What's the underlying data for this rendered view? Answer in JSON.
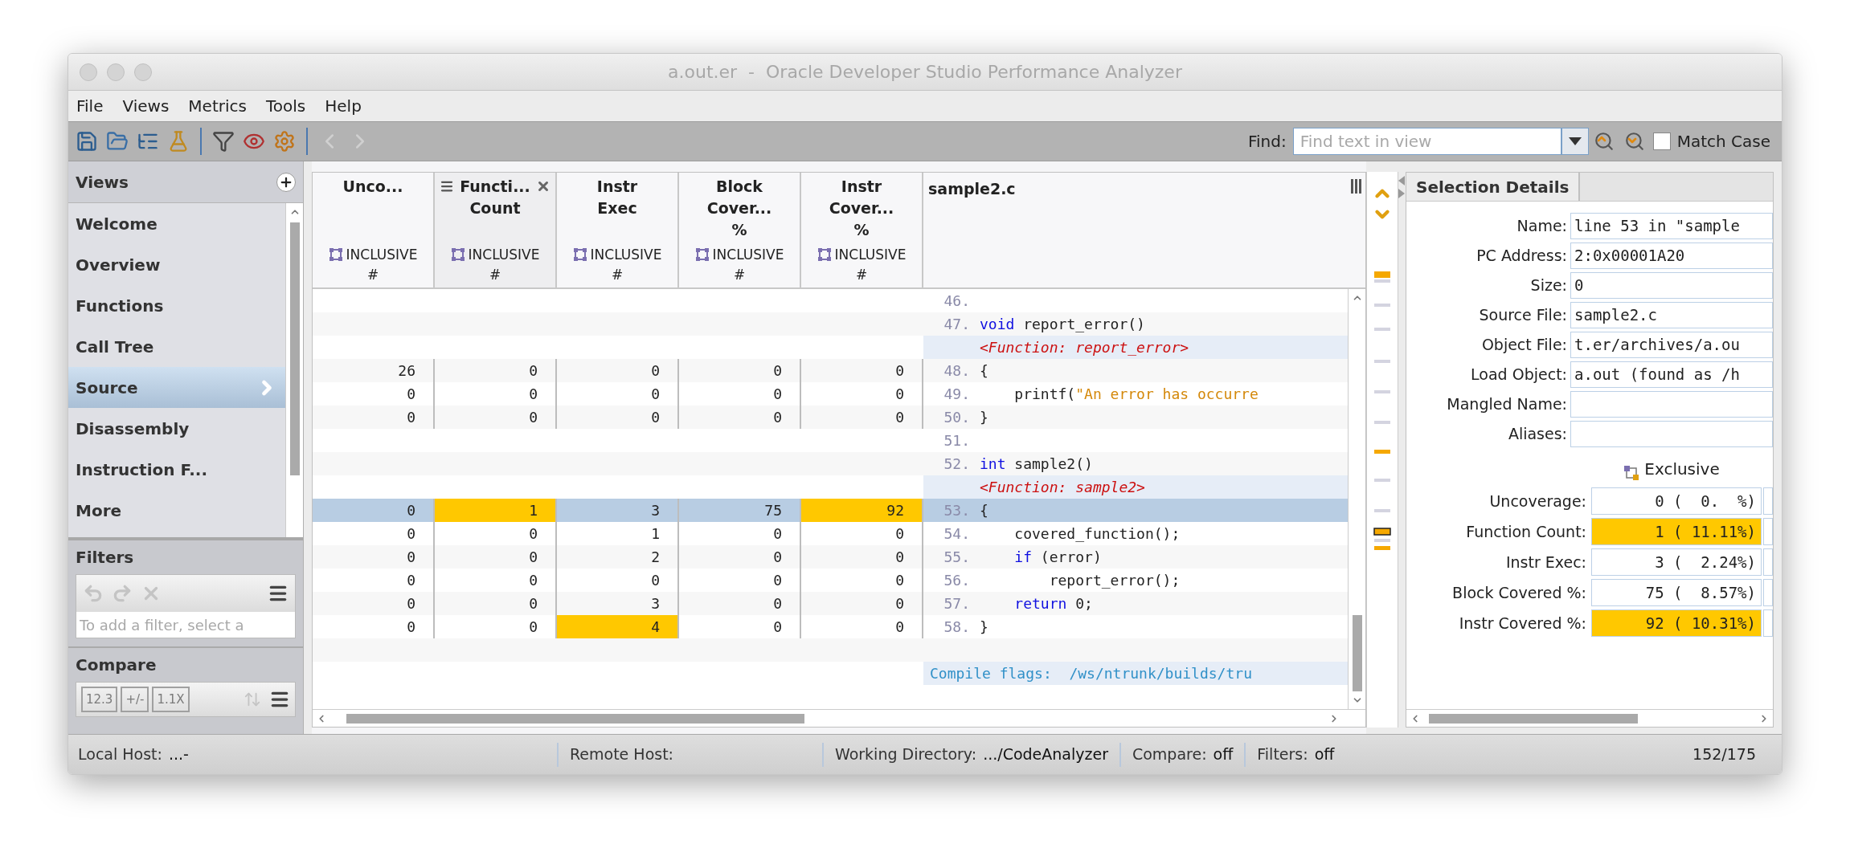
{
  "window": {
    "title": "a.out.er  -  Oracle Developer Studio Performance Analyzer"
  },
  "menu": [
    {
      "label": "File"
    },
    {
      "label": "Views"
    },
    {
      "label": "Metrics"
    },
    {
      "label": "Tools"
    },
    {
      "label": "Help"
    }
  ],
  "find": {
    "label": "Find:",
    "placeholder": "Find text in view",
    "match_case": {
      "label": "Match Case",
      "checked": false
    }
  },
  "sidebar": {
    "title": "Views",
    "items": [
      {
        "label": "Welcome",
        "selected": false
      },
      {
        "label": "Overview",
        "selected": false
      },
      {
        "label": "Functions",
        "selected": false
      },
      {
        "label": "Call Tree",
        "selected": false
      },
      {
        "label": "Source",
        "selected": true
      },
      {
        "label": "Disassembly",
        "selected": false
      },
      {
        "label": "Instruction F...",
        "selected": false
      },
      {
        "label": "More",
        "selected": false
      }
    ]
  },
  "filters": {
    "title": "Filters",
    "placeholder": "To add a filter, select a"
  },
  "compare": {
    "title": "Compare",
    "buttons": [
      "12.3",
      "+/-",
      "1.1X"
    ]
  },
  "table": {
    "columns": [
      {
        "title": [
          "Unco..."
        ],
        "scope": "INCLUSIVE",
        "unit": "#",
        "sorted": false
      },
      {
        "title": [
          "Functi...",
          "Count"
        ],
        "scope": "INCLUSIVE",
        "unit": "#",
        "sorted": true
      },
      {
        "title": [
          "Instr",
          "Exec"
        ],
        "scope": "INCLUSIVE",
        "unit": "#",
        "sorted": false
      },
      {
        "title": [
          "Block",
          "Cover...",
          "%"
        ],
        "scope": "INCLUSIVE",
        "unit": "#",
        "sorted": false
      },
      {
        "title": [
          "Instr",
          "Cover...",
          "%"
        ],
        "scope": "INCLUSIVE",
        "unit": "#",
        "sorted": false
      }
    ],
    "source_title": "sample2.c",
    "rows": [
      {
        "kind": "line",
        "number": "46.",
        "selected": false
      },
      {
        "kind": "line",
        "number": "47.",
        "selected": false,
        "code": [
          {
            "text": "void",
            "kind": "keyword"
          },
          {
            "text": " report_error()",
            "kind": "plain"
          }
        ]
      },
      {
        "kind": "function",
        "label": "<Function: report_error>",
        "selected": false
      },
      {
        "kind": "line",
        "number": "48.",
        "selected": false,
        "values": [
          {
            "text": "26",
            "hot": false
          },
          {
            "text": "0",
            "hot": false
          },
          {
            "text": "0",
            "hot": false
          },
          {
            "text": "0",
            "hot": false
          },
          {
            "text": "0",
            "hot": false
          }
        ],
        "code": [
          {
            "text": "{",
            "kind": "plain"
          }
        ]
      },
      {
        "kind": "line",
        "number": "49.",
        "selected": false,
        "values": [
          {
            "text": "0",
            "hot": false
          },
          {
            "text": "0",
            "hot": false
          },
          {
            "text": "0",
            "hot": false
          },
          {
            "text": "0",
            "hot": false
          },
          {
            "text": "0",
            "hot": false
          }
        ],
        "code": [
          {
            "text": "    printf(",
            "kind": "plain"
          },
          {
            "text": "\"An error has occurre",
            "kind": "string"
          }
        ]
      },
      {
        "kind": "line",
        "number": "50.",
        "selected": false,
        "values": [
          {
            "text": "0",
            "hot": false
          },
          {
            "text": "0",
            "hot": false
          },
          {
            "text": "0",
            "hot": false
          },
          {
            "text": "0",
            "hot": false
          },
          {
            "text": "0",
            "hot": false
          }
        ],
        "code": [
          {
            "text": "}",
            "kind": "plain"
          }
        ]
      },
      {
        "kind": "line",
        "number": "51.",
        "selected": false
      },
      {
        "kind": "line",
        "number": "52.",
        "selected": false,
        "code": [
          {
            "text": "int",
            "kind": "keyword"
          },
          {
            "text": " sample2()",
            "kind": "plain"
          }
        ]
      },
      {
        "kind": "function",
        "label": "<Function: sample2>",
        "selected": false
      },
      {
        "kind": "line",
        "number": "53.",
        "selected": true,
        "values": [
          {
            "text": "0",
            "hot": false
          },
          {
            "text": "1",
            "hot": true
          },
          {
            "text": "3",
            "hot": false
          },
          {
            "text": "75",
            "hot": false
          },
          {
            "text": "92",
            "hot": true
          }
        ],
        "code": [
          {
            "text": "{",
            "kind": "plain"
          }
        ]
      },
      {
        "kind": "line",
        "number": "54.",
        "selected": false,
        "values": [
          {
            "text": "0",
            "hot": false
          },
          {
            "text": "0",
            "hot": false
          },
          {
            "text": "1",
            "hot": false
          },
          {
            "text": "0",
            "hot": false
          },
          {
            "text": "0",
            "hot": false
          }
        ],
        "code": [
          {
            "text": "    covered_function();",
            "kind": "plain"
          }
        ]
      },
      {
        "kind": "line",
        "number": "55.",
        "selected": false,
        "values": [
          {
            "text": "0",
            "hot": false
          },
          {
            "text": "0",
            "hot": false
          },
          {
            "text": "2",
            "hot": false
          },
          {
            "text": "0",
            "hot": false
          },
          {
            "text": "0",
            "hot": false
          }
        ],
        "code": [
          {
            "text": "    if",
            "kind": "keyword"
          },
          {
            "text": " (error)",
            "kind": "plain"
          }
        ]
      },
      {
        "kind": "line",
        "number": "56.",
        "selected": false,
        "values": [
          {
            "text": "0",
            "hot": false
          },
          {
            "text": "0",
            "hot": false
          },
          {
            "text": "0",
            "hot": false
          },
          {
            "text": "0",
            "hot": false
          },
          {
            "text": "0",
            "hot": false
          }
        ],
        "code": [
          {
            "text": "        report_error();",
            "kind": "plain"
          }
        ]
      },
      {
        "kind": "line",
        "number": "57.",
        "selected": false,
        "values": [
          {
            "text": "0",
            "hot": false
          },
          {
            "text": "0",
            "hot": false
          },
          {
            "text": "3",
            "hot": false
          },
          {
            "text": "0",
            "hot": false
          },
          {
            "text": "0",
            "hot": false
          }
        ],
        "code": [
          {
            "text": "    return",
            "kind": "keyword"
          },
          {
            "text": " 0;",
            "kind": "plain"
          }
        ]
      },
      {
        "kind": "line",
        "number": "58.",
        "selected": false,
        "values": [
          {
            "text": "0",
            "hot": false
          },
          {
            "text": "0",
            "hot": false
          },
          {
            "text": "4",
            "hot": true
          },
          {
            "text": "0",
            "hot": false
          },
          {
            "text": "0",
            "hot": false
          }
        ],
        "code": [
          {
            "text": "}",
            "kind": "plain"
          }
        ]
      },
      {
        "kind": "blank",
        "selected": false
      },
      {
        "kind": "compile",
        "label": "Compile flags:  /ws/ntrunk/builds/tru",
        "selected": false
      }
    ]
  },
  "details": {
    "tab": "Selection Details",
    "fields": [
      {
        "label": "Name:",
        "value": "line 53 in \"sample"
      },
      {
        "label": "PC Address:",
        "value": "2:0x00001A20"
      },
      {
        "label": "Size:",
        "value": "0"
      },
      {
        "label": "Source File:",
        "value": "sample2.c"
      },
      {
        "label": "Object File:",
        "value": "t.er/archives/a.ou"
      },
      {
        "label": "Load Object:",
        "value": "a.out (found as /h"
      },
      {
        "label": "Mangled Name:"
      },
      {
        "label": "Aliases:"
      }
    ],
    "metrics_header": "Exclusive",
    "metrics": [
      {
        "label": "Uncoverage:",
        "value": "0 (  0.  %)",
        "hot": false
      },
      {
        "label": "Function Count:",
        "value": "1 ( 11.11%)",
        "hot": true
      },
      {
        "label": "Instr Exec:",
        "value": "3 (  2.24%)",
        "hot": false
      },
      {
        "label": "Block Covered %:",
        "value": "75 (  8.57%)",
        "hot": false
      },
      {
        "label": "Instr Covered %:",
        "value": "92 ( 10.31%)",
        "hot": true
      }
    ]
  },
  "status_bar": [
    {
      "label": "Local Host:",
      "value": "...-"
    },
    {
      "label": "Remote Host:"
    },
    {
      "label": "Working Directory:",
      "value": ".../CodeAnalyzer"
    },
    {
      "label": "Compare:",
      "value": "off"
    },
    {
      "label": "Filters:",
      "value": "off"
    }
  ],
  "status_count": "152/175"
}
